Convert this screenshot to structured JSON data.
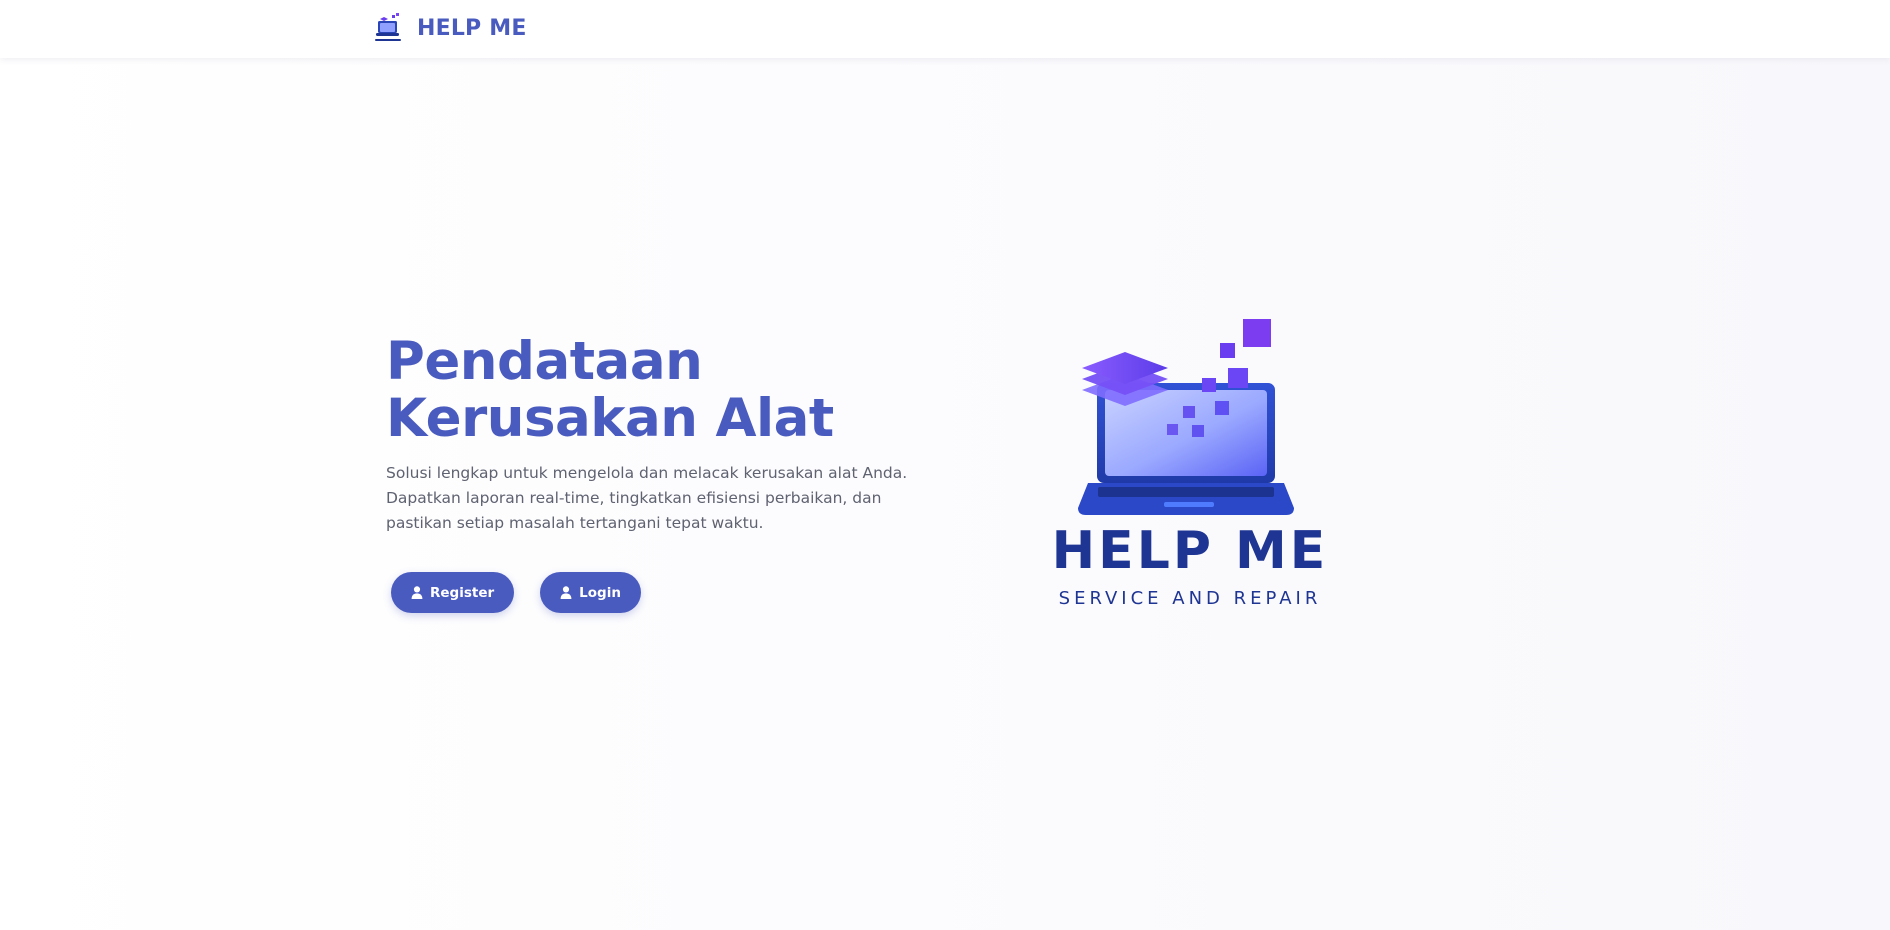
{
  "header": {
    "brand_name": "HELP ME",
    "logo_icon": "laptop-logo-icon"
  },
  "hero": {
    "title_line1": "Pendataan",
    "title_line2": "Kerusakan Alat",
    "description": "Solusi lengkap untuk mengelola dan melacak kerusakan alat Anda. Dapatkan laporan real-time, tingkatkan efisiensi perbaikan, dan pastikan setiap masalah tertangani tepat waktu.",
    "buttons": {
      "register_label": "Register",
      "login_label": "Login",
      "icon": "user-icon"
    }
  },
  "illustration": {
    "title": "HELP ME",
    "subtitle": "SERVICE AND REPAIR"
  },
  "colors": {
    "primary": "#4a5bbf",
    "logo_dark": "#1f3593",
    "accent_purple": "#6b3df0",
    "text_muted": "#5f6270",
    "background": "#f9f9fc"
  }
}
